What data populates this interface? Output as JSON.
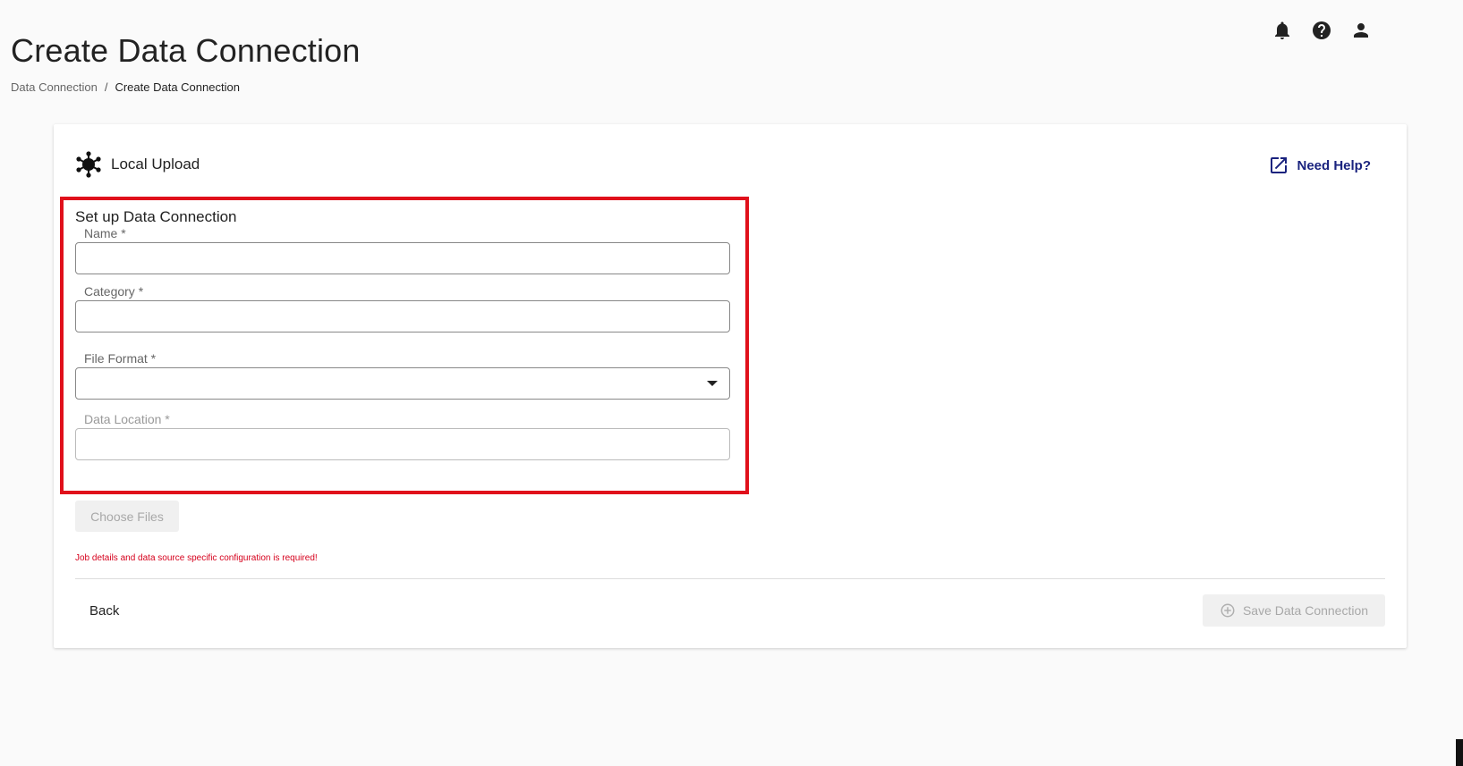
{
  "header": {
    "title": "Create Data Connection",
    "icons": [
      "bell-icon",
      "help-circle-icon",
      "account-icon"
    ]
  },
  "breadcrumb": {
    "parent": "Data Connection",
    "separator": "/",
    "current": "Create Data Connection"
  },
  "card": {
    "source_icon": "hub-network-icon",
    "source_label": "Local Upload",
    "help_icon": "open-in-new-icon",
    "help_label": "Need Help?",
    "section_title": "Set up Data Connection",
    "fields": {
      "name": {
        "label": "Name *",
        "value": ""
      },
      "category": {
        "label": "Category *",
        "value": ""
      },
      "file_format": {
        "label": "File Format *",
        "value": ""
      },
      "data_location": {
        "label": "Data Location *",
        "value": ""
      }
    },
    "choose_files_label": "Choose Files",
    "error_message": "Job details and data source specific configuration is required!",
    "back_label": "Back",
    "save_label": "Save Data Connection"
  },
  "colors": {
    "highlight": "#e0101b",
    "error": "#d6001c",
    "link": "#1a237e"
  }
}
